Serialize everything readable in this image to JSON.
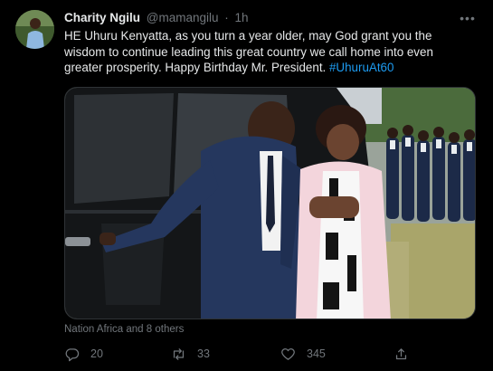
{
  "tweet": {
    "author_name": "Charity Ngilu",
    "handle": "@mamangilu",
    "separator": "·",
    "time": "1h",
    "more_label": "•••",
    "text_main": "HE Uhuru Kenyatta, as you turn a year older, may God grant you the wisdom to continue leading this great country we call home into even greater prosperity. Happy Birthday Mr. President. ",
    "hashtag": "#UhuruAt60",
    "media_tagged": "Nation Africa and 8 others"
  },
  "actions": {
    "reply_count": "20",
    "retweet_count": "33",
    "like_count": "345"
  },
  "colors": {
    "background": "#000000",
    "text": "#e7e9ea",
    "muted": "#71767b",
    "accent": "#1d9bf0"
  },
  "icons": [
    "reply-icon",
    "retweet-icon",
    "like-icon",
    "share-icon",
    "more-icon"
  ]
}
